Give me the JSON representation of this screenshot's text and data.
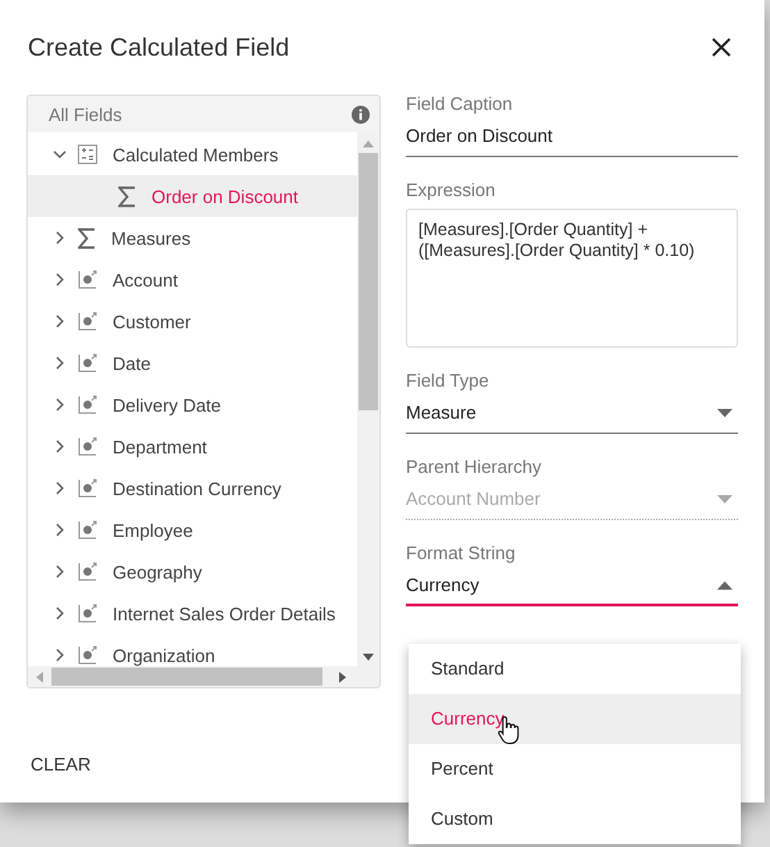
{
  "dialog": {
    "title": "Create Calculated Field"
  },
  "tree": {
    "header": "All Fields",
    "items": [
      {
        "label": "Calculated Members",
        "kind": "calc",
        "expanded": true,
        "selected": false,
        "children": [
          {
            "label": "Order on Discount",
            "kind": "measure",
            "selected": true
          }
        ]
      },
      {
        "label": "Measures",
        "kind": "measure",
        "expanded": false,
        "selected": false
      },
      {
        "label": "Account",
        "kind": "dimension",
        "expanded": false,
        "selected": false
      },
      {
        "label": "Customer",
        "kind": "dimension",
        "expanded": false,
        "selected": false
      },
      {
        "label": "Date",
        "kind": "dimension",
        "expanded": false,
        "selected": false
      },
      {
        "label": "Delivery Date",
        "kind": "dimension",
        "expanded": false,
        "selected": false
      },
      {
        "label": "Department",
        "kind": "dimension",
        "expanded": false,
        "selected": false
      },
      {
        "label": "Destination Currency",
        "kind": "dimension",
        "expanded": false,
        "selected": false
      },
      {
        "label": "Employee",
        "kind": "dimension",
        "expanded": false,
        "selected": false
      },
      {
        "label": "Geography",
        "kind": "dimension",
        "expanded": false,
        "selected": false
      },
      {
        "label": "Internet Sales Order Details",
        "kind": "dimension",
        "expanded": false,
        "selected": false
      },
      {
        "label": "Organization",
        "kind": "dimension",
        "expanded": false,
        "selected": false
      }
    ]
  },
  "fields": [
    {
      "kind": "text",
      "label": "Field Caption",
      "value": "Order on Discount"
    },
    {
      "kind": "textarea",
      "label": "Expression",
      "value": "[Measures].[Order Quantity] + ([Measures].[Order Quantity] * 0.10)"
    },
    {
      "kind": "dropdown",
      "label": "Field Type",
      "value": "Measure",
      "disabled": false,
      "open": false
    },
    {
      "kind": "dropdown",
      "label": "Parent Hierarchy",
      "value": "Account Number",
      "disabled": true,
      "open": false
    },
    {
      "kind": "dropdown",
      "label": "Format String",
      "value": "Currency",
      "disabled": false,
      "open": true
    }
  ],
  "popup": {
    "options": [
      {
        "label": "Standard",
        "selected": false
      },
      {
        "label": "Currency",
        "selected": true
      },
      {
        "label": "Percent",
        "selected": false
      },
      {
        "label": "Custom",
        "selected": false
      }
    ]
  },
  "buttons": [
    "CLEAR"
  ]
}
